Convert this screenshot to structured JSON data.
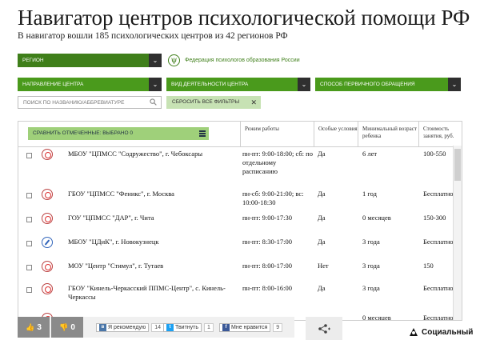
{
  "header": {
    "title": "Навигатор центров психологической помощи РФ",
    "subtitle": "В навигатор вошли 185 психологических центров из 42 регионов РФ"
  },
  "filters": {
    "region": "РЕГИОН",
    "federation": "Федерация психологов образования России",
    "direction": "НАПРАВЛЕНИЕ ЦЕНТРА",
    "activity": "ВИД ДЕЯТЕЛЬНОСТИ ЦЕНТРА",
    "contact": "СПОСОБ ПЕРВИЧНОГО ОБРАЩЕНИЯ",
    "search_placeholder": "ПОИСК ПО НАЗВАНИЮ/АББРЕВИАТУРЕ",
    "reset": "СБРОСИТЬ ВСЕ ФИЛЬТРЫ",
    "reset_icon": "close-icon"
  },
  "table": {
    "compare_label": "СРАВНИТЬ ОТМЕЧЕННЫЕ: ВЫБРАНО 0",
    "headers": {
      "hours": "Режим работы",
      "special": "Особые условия",
      "min_age": "Минимальный возраст ребенка",
      "cost": "Стоимость занятия, руб."
    },
    "rows": [
      {
        "name": "МБОУ \"ЦПМСС \"Содружество\", г. Чебоксары",
        "hours": "пн-пт: 9:00-18:00; сб: по отдельному расписанию",
        "special": "Да",
        "age": "6 лет",
        "cost": "100-550",
        "icon": "target-icon"
      },
      {
        "name": "ГБОУ \"ЦПМСС \"Феникс\", г. Москва",
        "hours": "пн-сб: 9:00-21:00; вс: 10:00-18:30",
        "special": "Да",
        "age": "1 год",
        "cost": "Бесплатно",
        "icon": "target-icon"
      },
      {
        "name": "ГОУ \"ЦПМСС \"ДАР\", г. Чита",
        "hours": "пн-пт: 9:00-17:30",
        "special": "Да",
        "age": "0 месяцев",
        "cost": "150-300",
        "icon": "target-icon"
      },
      {
        "name": "МБОУ \"ЦДиК\", г. Новокузнецк",
        "hours": "пн-пт: 8:30-17:00",
        "special": "Да",
        "age": "3 года",
        "cost": "Бесплатно",
        "icon": "pencil-icon"
      },
      {
        "name": "МОУ \"Центр \"Стимул\", г. Тутаев",
        "hours": "пн-пт: 8:00-17:00",
        "special": "Нет",
        "age": "3 года",
        "cost": "150",
        "icon": "target-icon"
      },
      {
        "name": "ГБОУ \"Кинель-Черкасский ППМС-Центр\", с. Кинель-Черкассы",
        "hours": "пн-пт: 8:00-16:00",
        "special": "Да",
        "age": "3 года",
        "cost": "Бесплатно",
        "icon": "target-icon"
      },
      {
        "name": "",
        "hours": "",
        "special": "",
        "age": "0 месяцев",
        "cost": "Бесплатно",
        "icon": "target-icon"
      }
    ]
  },
  "footer": {
    "likes": "3",
    "dislikes": "0",
    "vk_label": "Я рекомендую",
    "vk_count": "14",
    "tw_label": "Твитнуть",
    "tw_count": "1",
    "fb_label": "Мне нравится",
    "fb_count": "9",
    "share_icon": "share-icon",
    "socnet_label": "Социальный"
  }
}
